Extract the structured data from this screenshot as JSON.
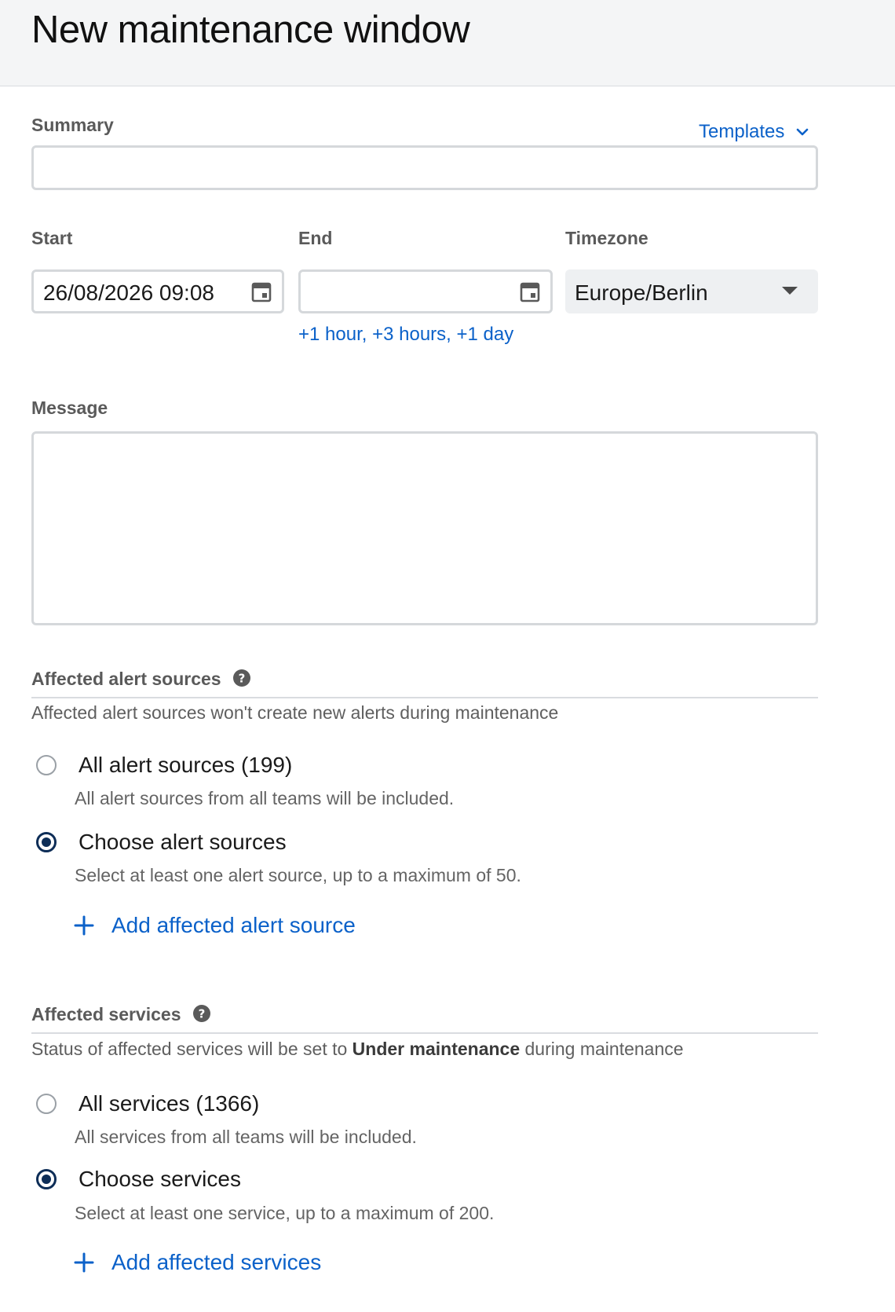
{
  "header": {
    "title": "New maintenance window"
  },
  "summary": {
    "label": "Summary",
    "value": "",
    "templates_label": "Templates"
  },
  "start": {
    "label": "Start",
    "value": "26/08/2026 09:08"
  },
  "end": {
    "label": "End",
    "value": ""
  },
  "timezone": {
    "label": "Timezone",
    "value": "Europe/Berlin"
  },
  "quick_links": [
    "+1 hour,",
    " +3 hours,",
    " +1 day"
  ],
  "message": {
    "label": "Message",
    "value": ""
  },
  "alert_sources": {
    "title": "Affected alert sources",
    "description": "Affected alert sources won't create new alerts during maintenance",
    "options": [
      {
        "label": "All alert sources (199)",
        "sub": "All alert sources from all teams will be included.",
        "checked": false
      },
      {
        "label": "Choose alert sources",
        "sub": "Select at least one alert source, up to a maximum of 50.",
        "checked": true
      }
    ],
    "add_label": "Add affected alert source"
  },
  "services": {
    "title": "Affected services",
    "description_pre": "Status of affected services will be set to ",
    "description_bold": "Under maintenance",
    "description_post": " during maintenance",
    "options": [
      {
        "label": "All services (1366)",
        "sub": "All services from all teams will be included.",
        "checked": false
      },
      {
        "label": "Choose services",
        "sub": "Select at least one service, up to a maximum of 200.",
        "checked": true
      }
    ],
    "add_label": "Add affected services"
  },
  "colors": {
    "link": "#0b61c9",
    "radio_checked": "#0d2d57",
    "header_bg": "#f4f5f6"
  }
}
